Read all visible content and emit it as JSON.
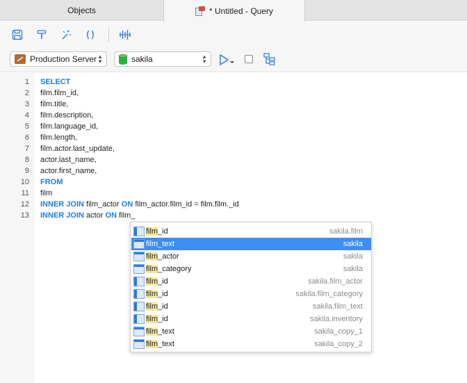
{
  "tabs": {
    "objects": "Objects",
    "query": "* Untitled - Query"
  },
  "toolbar": {
    "icons": [
      "save-icon",
      "format-icon",
      "magic-wand-icon",
      "parentheses-icon",
      "beautify-icon"
    ]
  },
  "connection": {
    "server": "Production Server",
    "database": "sakila"
  },
  "editor": {
    "lines": [
      {
        "n": "1",
        "kw": "SELECT",
        "text": ""
      },
      {
        "n": "2",
        "kw": "",
        "text": "film.film_id,"
      },
      {
        "n": "3",
        "kw": "",
        "text": "film.title,"
      },
      {
        "n": "4",
        "kw": "",
        "text": "film.description,"
      },
      {
        "n": "5",
        "kw": "",
        "text": "film.language_id,"
      },
      {
        "n": "6",
        "kw": "",
        "text": "film.length,"
      },
      {
        "n": "7",
        "kw": "",
        "text": "film.actor.last_update,"
      },
      {
        "n": "8",
        "kw": "",
        "text": "actor.last_name,"
      },
      {
        "n": "9",
        "kw": "",
        "text": "actor.first_name,"
      },
      {
        "n": "10",
        "kw": "FROM",
        "text": ""
      },
      {
        "n": "11",
        "kw": "",
        "text": "film"
      },
      {
        "n": "12",
        "parts": [
          [
            "kw",
            "INNER JOIN"
          ],
          [
            "t",
            " film_actor "
          ],
          [
            "kw",
            "ON"
          ],
          [
            "t",
            " film_actor.film_id = film.film._id"
          ]
        ]
      },
      {
        "n": "13",
        "parts": [
          [
            "kw",
            "INNER JOIN"
          ],
          [
            "t",
            " actor "
          ],
          [
            "kw",
            "ON"
          ],
          [
            "t",
            " film_"
          ]
        ]
      }
    ]
  },
  "autocomplete": {
    "items": [
      {
        "prefix": "film",
        "rest": "_id",
        "owner": "sakila.film",
        "kind": "col"
      },
      {
        "prefix": "film",
        "rest": "_text",
        "owner": "sakila",
        "kind": "table",
        "selected": true
      },
      {
        "prefix": "film",
        "rest": "_actor",
        "owner": "sakila",
        "kind": "table"
      },
      {
        "prefix": "film",
        "rest": "_category",
        "owner": "sakila",
        "kind": "table"
      },
      {
        "prefix": "film",
        "rest": "_id",
        "owner": "sakila.film_actor",
        "kind": "col"
      },
      {
        "prefix": "film",
        "rest": "_id",
        "owner": "sakila.film_category",
        "kind": "col"
      },
      {
        "prefix": "film",
        "rest": "_id",
        "owner": "sakila.film_text",
        "kind": "col"
      },
      {
        "prefix": "film",
        "rest": "_id",
        "owner": "sakila.inventory",
        "kind": "col"
      },
      {
        "prefix": "film",
        "rest": "_text",
        "owner": "sakila_copy_1",
        "kind": "table"
      },
      {
        "prefix": "film",
        "rest": "_text",
        "owner": "sakila_copy_2",
        "kind": "table"
      }
    ]
  },
  "colors": {
    "keyword": "#1a7ee0",
    "selection": "#3d8ef0",
    "match_highlight": "#f7e79a"
  }
}
